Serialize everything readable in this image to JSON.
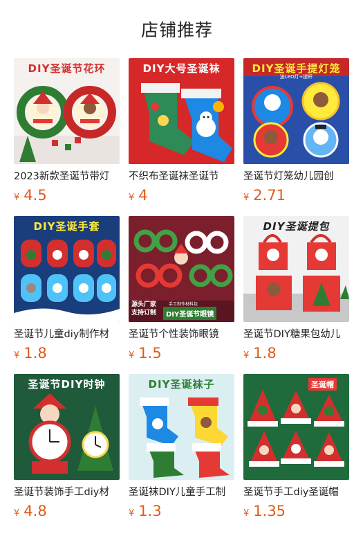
{
  "header": {
    "title": "店铺推荐"
  },
  "products": [
    {
      "title": "2023新款圣诞节带灯",
      "currency": "¥",
      "price": "4.5",
      "banner": "DIY圣诞节花环",
      "tags": []
    },
    {
      "title": "不织布圣诞袜圣诞节",
      "currency": "¥",
      "price": "4",
      "banner": "DIY大号圣诞袜",
      "tags": []
    },
    {
      "title": "圣诞节灯笼幼儿园创",
      "currency": "¥",
      "price": "2.71",
      "banner": "DIY圣诞手提灯笼",
      "tags": [
        "送LED灯+提杆"
      ]
    },
    {
      "title": "圣诞节儿童diy制作材",
      "currency": "¥",
      "price": "1.8",
      "banner": "DIY圣诞手套",
      "tags": []
    },
    {
      "title": "圣诞节个性装饰眼镜",
      "currency": "¥",
      "price": "1.5",
      "banner": "",
      "tags": [
        "源头厂家",
        "支持订制",
        "手工制作材料包",
        "DIY圣诞节眼镜"
      ]
    },
    {
      "title": "圣诞节DIY糖果包幼儿",
      "currency": "¥",
      "price": "1.8",
      "banner": "DIY圣诞提包",
      "tags": []
    },
    {
      "title": "圣诞节装饰手工diy材",
      "currency": "¥",
      "price": "4.8",
      "banner": "圣诞节DIY时钟",
      "tags": []
    },
    {
      "title": "圣诞袜DIY儿童手工制",
      "currency": "¥",
      "price": "1.3",
      "banner": "DIY圣诞袜子",
      "tags": []
    },
    {
      "title": "圣诞节手工diy圣诞帽",
      "currency": "¥",
      "price": "1.35",
      "banner": "圣诞帽",
      "tags": []
    }
  ],
  "colors": {
    "price": "#e35a17",
    "title_text": "#222222"
  }
}
